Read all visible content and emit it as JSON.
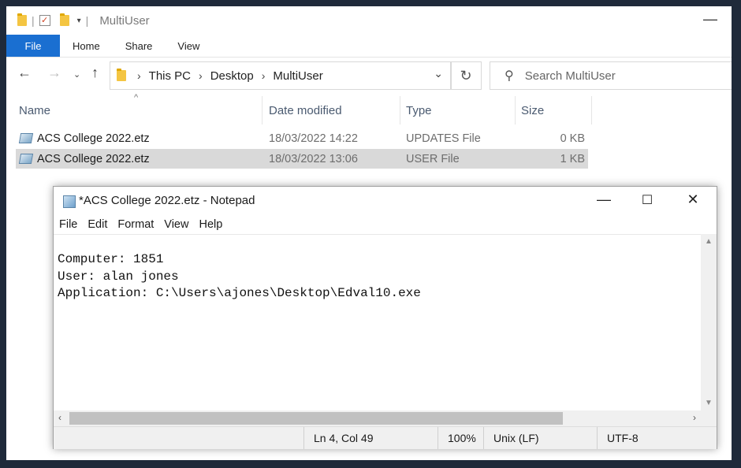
{
  "explorer": {
    "title": "MultiUser",
    "ribbon_tabs": [
      "File",
      "Home",
      "Share",
      "View"
    ],
    "breadcrumb": [
      "This PC",
      "Desktop",
      "MultiUser"
    ],
    "search_placeholder": "Search MultiUser",
    "columns": {
      "name": "Name",
      "date": "Date modified",
      "type": "Type",
      "size": "Size"
    },
    "files": [
      {
        "name": "ACS College 2022.etz",
        "date": "18/03/2022 14:22",
        "type": "UPDATES File",
        "size": "0 KB",
        "selected": false
      },
      {
        "name": "ACS College 2022.etz",
        "date": "18/03/2022 13:06",
        "type": "USER File",
        "size": "1 KB",
        "selected": true
      }
    ]
  },
  "notepad": {
    "title": "*ACS College 2022.etz - Notepad",
    "menu": [
      "File",
      "Edit",
      "Format",
      "View",
      "Help"
    ],
    "lines": [
      "Computer: 1851",
      "User: alan jones",
      "Application: C:\\Users\\ajones\\Desktop\\Edval10.exe"
    ],
    "status": {
      "position": "Ln 4, Col 49",
      "zoom": "100%",
      "line_ending": "Unix (LF)",
      "encoding": "UTF-8"
    }
  },
  "colors": {
    "file_tab": "#1a6fd1",
    "selection": "#d9d9d9",
    "desktop": "#1f2a3a"
  },
  "icons": [
    "folder-icon",
    "checkmark-icon",
    "back-arrow-icon",
    "forward-arrow-icon",
    "up-arrow-icon",
    "refresh-icon",
    "search-icon",
    "minimize-icon",
    "maximize-icon",
    "close-icon"
  ]
}
